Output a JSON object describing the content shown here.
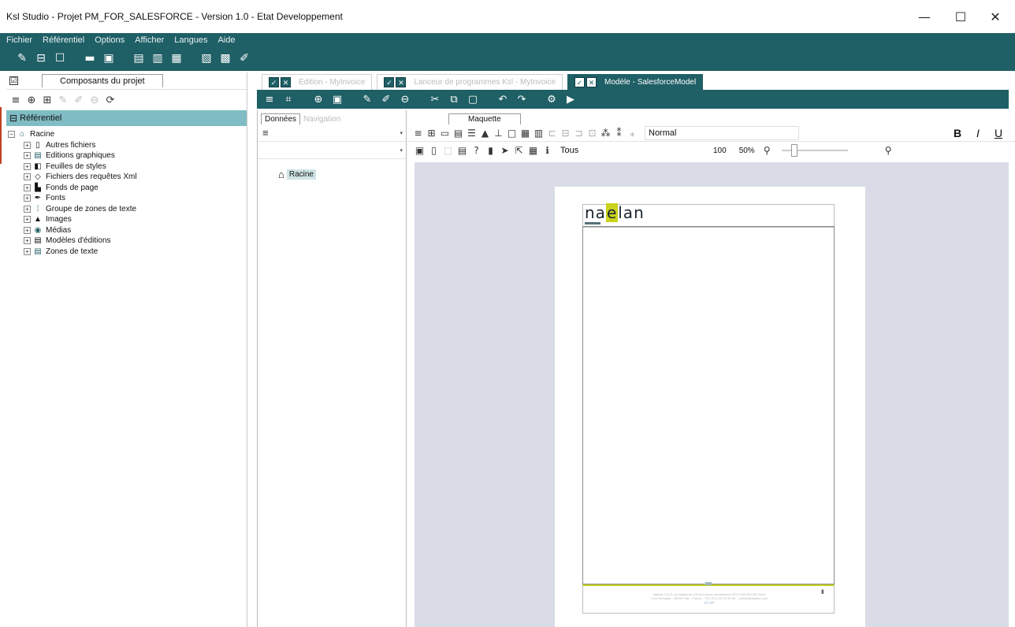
{
  "window": {
    "title": "Ksl Studio - Projet PM_FOR_SALESFORCE - Version 1.0 - Etat Developpement",
    "minimize": "—",
    "maximize": "☐",
    "close": "✕"
  },
  "menu": [
    "Fichier",
    "Référentiel",
    "Options",
    "Afficher",
    "Langues",
    "Aide"
  ],
  "left_panel": {
    "tab": "Composants du projet",
    "section_header": "Référentiel",
    "root": "Racine",
    "items": [
      "Autres fichiers",
      "Editions graphiques",
      "Feuilles de styles",
      "Fichiers des requêtes Xml",
      "Fonds de page",
      "Fonts",
      "Groupe de zones de texte",
      "Images",
      "Médias",
      "Modèles d'éditions",
      "Zones de texte"
    ]
  },
  "doc_tabs": [
    {
      "label": "Edition - MyInvoice",
      "active": false
    },
    {
      "label": "Lanceur de programmes Ksl - MyInvoice",
      "active": false
    },
    {
      "label": "Modèle - SalesforceModel",
      "active": true
    }
  ],
  "middle_panel": {
    "tabs": [
      "Données",
      "Navigation"
    ],
    "node": "Racine"
  },
  "right_panel": {
    "tab": "Maquette",
    "style_value": "Normal",
    "bold": "B",
    "italic": "I",
    "underline": "U",
    "filter_value": "Tous",
    "zoom_primary": "100",
    "zoom_secondary": "50%"
  },
  "document": {
    "logo_pre": "na",
    "logo_e": "e",
    "logo_post": "lan",
    "footer_line1": "Naelan S.A.S. au capital de 100 000 euros immatriculée RCS 000 000 000 Siret",
    "footer_line2": "1 rue Exemple - 00000 Ville - France - Tél +33 1 00 00 00 00 - contact@naelan.com",
    "footer_line3": "p1 | p2"
  },
  "colors": {
    "accent": "#1f5f66",
    "selection": "#7fbcc3",
    "canvas": "#d9dce6",
    "logo_highlight": "#c9d31e"
  }
}
